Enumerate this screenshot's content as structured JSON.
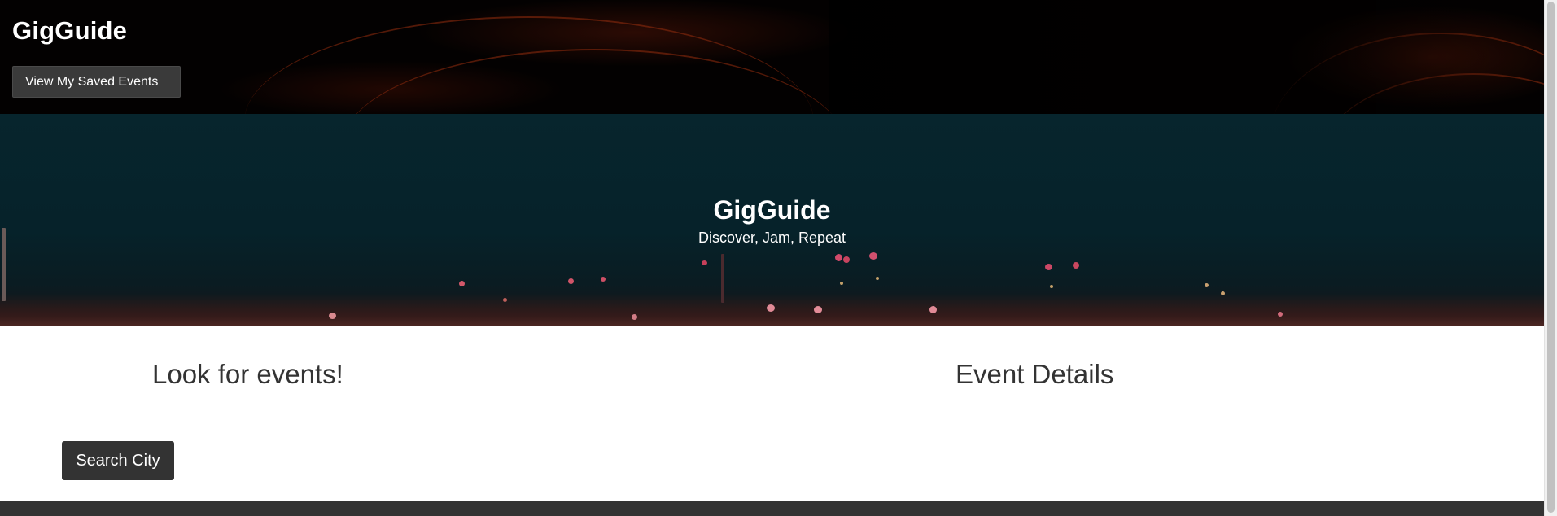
{
  "header": {
    "brand": "GigGuide",
    "saved_button": "View My Saved Events"
  },
  "hero": {
    "title": "GigGuide",
    "subtitle": "Discover, Jam, Repeat"
  },
  "main": {
    "search_heading": "Look for events!",
    "details_heading": "Event Details",
    "search_button": "Search City"
  },
  "colors": {
    "header_bg": "#030101",
    "hero_bg": "#07252d",
    "button_bg": "#333333",
    "footer_bg": "#333333",
    "heading_text": "#333333"
  }
}
